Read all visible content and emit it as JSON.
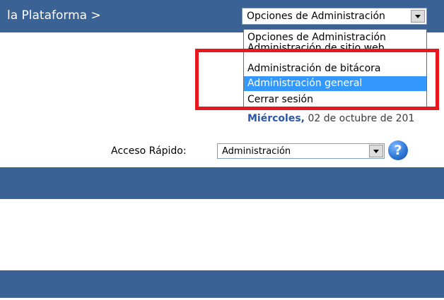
{
  "header": {
    "breadcrumb": "la Plataforma >",
    "admin_select": {
      "value": "Opciones de Administración",
      "options": [
        "Opciones de Administración",
        "Administración de sitio web",
        "Administración de bitácora",
        "Administración general",
        "Cerrar sesión"
      ],
      "selected_index": 3
    }
  },
  "date": {
    "day": "Miércoles,",
    "rest": "02 de octubre de 201"
  },
  "quick_access": {
    "label": "Acceso Rápido:",
    "value": "Administración",
    "help_icon": "?"
  },
  "colors": {
    "banner": "#3a6294",
    "highlight": "#e8171e",
    "selected_option": "#3399ff",
    "date_day": "#2a57a8"
  },
  "icons": {
    "dropdown": "chevron-down-icon",
    "help": "help-icon"
  }
}
